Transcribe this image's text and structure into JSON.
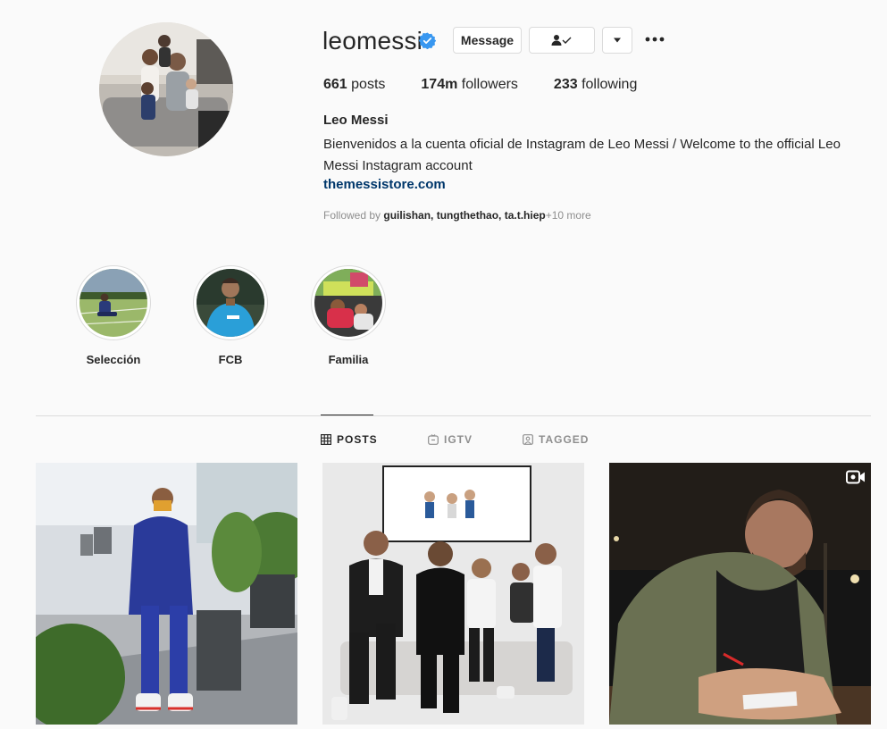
{
  "profile": {
    "username": "leomessi",
    "message_label": "Message",
    "stats": {
      "posts_count": "661",
      "posts_label": "posts",
      "followers_count": "174m",
      "followers_label": "followers",
      "following_count": "233",
      "following_label": "following"
    },
    "full_name": "Leo Messi",
    "bio": "Bienvenidos a la cuenta oficial de Instagram de Leo Messi / Welcome to the official Leo Messi Instagram account",
    "website": "themessistore.com",
    "followed_by": {
      "prefix": "Followed by",
      "users": "guilishan, tungthethao, ta.t.hiep",
      "more": "+10 more"
    }
  },
  "highlights": [
    {
      "label": "Selección"
    },
    {
      "label": "FCB"
    },
    {
      "label": "Familia"
    }
  ],
  "tabs": [
    {
      "label": "POSTS"
    },
    {
      "label": "IGTV"
    },
    {
      "label": "TAGGED"
    }
  ],
  "colors": {
    "verified": "#3897f0",
    "link": "#00376b",
    "border": "#dbdbdb",
    "background": "#fafafa"
  }
}
